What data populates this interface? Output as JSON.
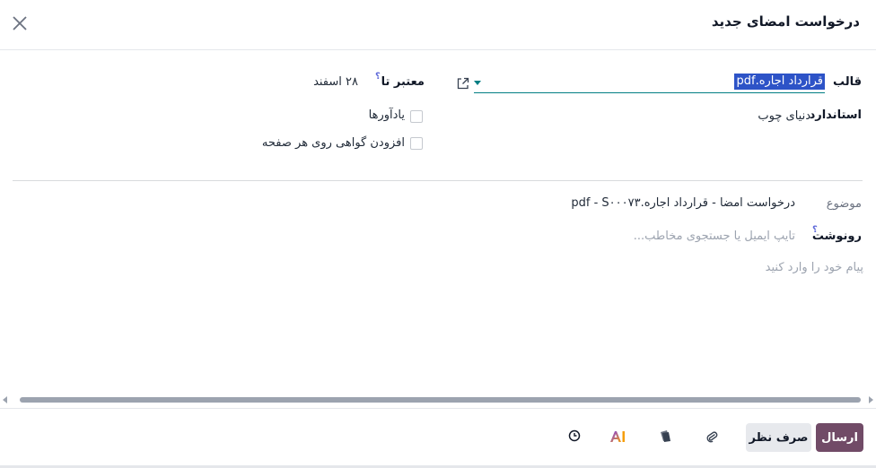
{
  "dialog": {
    "title": "درخواست امضای جدید",
    "close_icon": "close-icon"
  },
  "form": {
    "template_label": "قالب",
    "template_value": "قرارداد اجاره.pdf",
    "valid_until_label": "معتبر تا",
    "valid_until_help": "؟",
    "valid_until_value": "۲۸ اسفند",
    "tag_label": "استاندارد",
    "tag_value": "دنیای چوب",
    "reminders_label": "یادآورها",
    "certificate_label": "افزودن گواهی روی هر صفحه"
  },
  "message": {
    "subject_label": "موضوع",
    "subject_value": "درخواست امضا - قرارداد اجاره.pdf - S۰۰۰۷۳",
    "cc_label": "رونوشت",
    "cc_help": "؟",
    "cc_placeholder": "تایپ ایمیل یا جستجوی مخاطب...",
    "body_placeholder": "پیام خود را وارد کنید"
  },
  "footer": {
    "send_label": "ارسال",
    "discard_label": "صرف نظر",
    "ai_label": "AI"
  },
  "colors": {
    "primary": "#714b67",
    "accent": "#017e84",
    "selection": "#2d53c7"
  }
}
